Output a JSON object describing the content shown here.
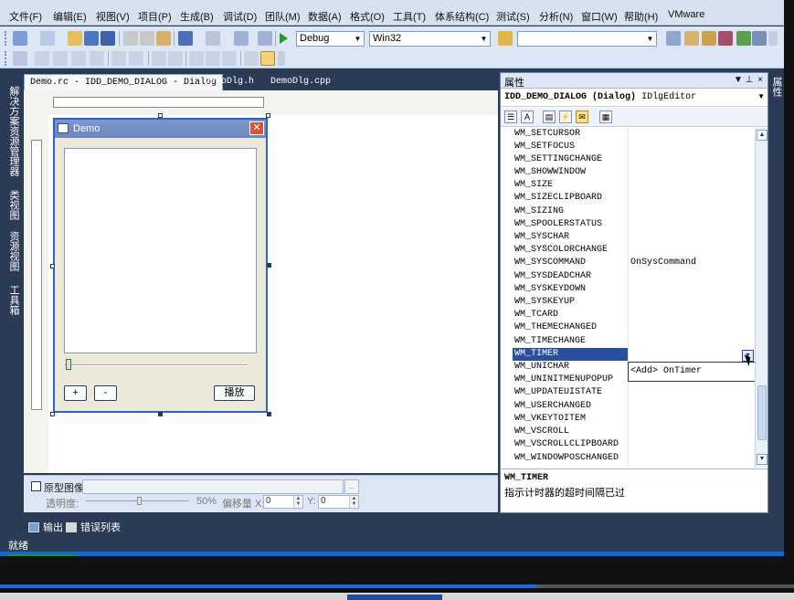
{
  "menu": {
    "items": [
      "文件(F)",
      "编辑(E)",
      "视图(V)",
      "项目(P)",
      "生成(B)",
      "调试(D)",
      "团队(M)",
      "数据(A)",
      "格式(O)",
      "工具(T)",
      "体系结构(C)",
      "测试(S)",
      "分析(N)",
      "窗口(W)",
      "帮助(H)",
      "VMware"
    ]
  },
  "toolbar": {
    "config_combo": "Debug",
    "platform_combo": "Win32",
    "find_combo": ""
  },
  "left_dock": {
    "tabs": [
      "解决方案资源管理器",
      "类视图",
      "资源视图",
      "工具箱"
    ]
  },
  "doc_tabs": [
    "Demo.rc - IDD_DEMO_DIALOG - Dialog",
    "DemoDlg.h",
    "DemoDlg.cpp"
  ],
  "dialog": {
    "title": "Demo",
    "buttons": [
      "+",
      "-",
      "播放"
    ],
    "slider_value": 0
  },
  "prototype_bar": {
    "checkbox_label": "原型图像:",
    "image_path": "",
    "browse_label": "...",
    "transparency_label": "透明度:",
    "transparency_value": "50%",
    "offset_x_label": "偏移量 X:",
    "offset_x_value": "0",
    "offset_y_label": "Y:",
    "offset_y_value": "0"
  },
  "output_tabs": [
    "输出",
    "错误列表"
  ],
  "status": {
    "text": "就绪"
  },
  "properties": {
    "title": "属性",
    "title_buttons": [
      "▼",
      "⊥",
      "×"
    ],
    "object_name": "IDD_DEMO_DIALOG",
    "object_type": "(Dialog)",
    "object_editor": "IDlgEditor",
    "rows": [
      {
        "name": "WM_SETCURSOR",
        "value": ""
      },
      {
        "name": "WM_SETFOCUS",
        "value": ""
      },
      {
        "name": "WM_SETTINGCHANGE",
        "value": ""
      },
      {
        "name": "WM_SHOWWINDOW",
        "value": ""
      },
      {
        "name": "WM_SIZE",
        "value": ""
      },
      {
        "name": "WM_SIZECLIPBOARD",
        "value": ""
      },
      {
        "name": "WM_SIZING",
        "value": ""
      },
      {
        "name": "WM_SPOOLERSTATUS",
        "value": ""
      },
      {
        "name": "WM_SYSCHAR",
        "value": ""
      },
      {
        "name": "WM_SYSCOLORCHANGE",
        "value": ""
      },
      {
        "name": "WM_SYSCOMMAND",
        "value": "OnSysCommand"
      },
      {
        "name": "WM_SYSDEADCHAR",
        "value": ""
      },
      {
        "name": "WM_SYSKEYDOWN",
        "value": ""
      },
      {
        "name": "WM_SYSKEYUP",
        "value": ""
      },
      {
        "name": "WM_TCARD",
        "value": ""
      },
      {
        "name": "WM_THEMECHANGED",
        "value": ""
      },
      {
        "name": "WM_TIMECHANGE",
        "value": ""
      },
      {
        "name": "WM_TIMER",
        "value": ""
      },
      {
        "name": "WM_UNICHAR",
        "value": ""
      },
      {
        "name": "WM_UNINITMENUPOPUP",
        "value": ""
      },
      {
        "name": "WM_UPDATEUISTATE",
        "value": ""
      },
      {
        "name": "WM_USERCHANGED",
        "value": ""
      },
      {
        "name": "WM_VKEYTOITEM",
        "value": ""
      },
      {
        "name": "WM_VSCROLL",
        "value": ""
      },
      {
        "name": "WM_VSCROLLCLIPBOARD",
        "value": ""
      },
      {
        "name": "WM_WINDOWPOSCHANGED",
        "value": ""
      }
    ],
    "selected_row": "WM_TIMER",
    "dropdown_option": "<Add> OnTimer",
    "description_title": "WM_TIMER",
    "description_text": "指示计时器的超时间隔已过"
  },
  "right_dock": {
    "tabs": [
      "属性"
    ]
  },
  "colors": {
    "ide_dark": "#2b3a55",
    "selection": "#2a4f9e",
    "video_progress": "#1b6ae0"
  }
}
